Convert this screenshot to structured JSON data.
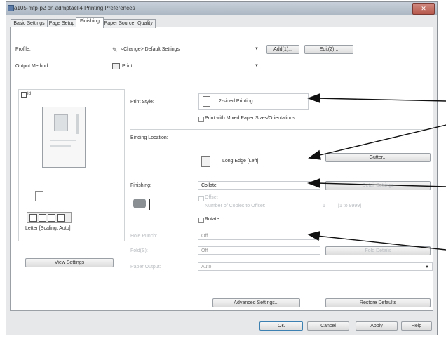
{
  "window": {
    "title": "a105-mfp-p2 on admptaeli4 Printing Preferences",
    "close_glyph": "✕"
  },
  "tabs": [
    {
      "label": "Basic Settings",
      "active": false
    },
    {
      "label": "Page Setup",
      "active": false
    },
    {
      "label": "Finishing",
      "active": true
    },
    {
      "label": "Paper Source",
      "active": false
    },
    {
      "label": "Quality",
      "active": false
    }
  ],
  "profile": {
    "label": "Profile:",
    "value": "<Change> Default Settings",
    "add_label": "Add(1)...",
    "edit_label": "Edit(2)..."
  },
  "output_method": {
    "label": "Output Method:",
    "value": "Print"
  },
  "preview": {
    "preview_label": "Id",
    "paper_caption": "Letter [Scaling: Auto]",
    "view_settings_label": "View Settings"
  },
  "print_style": {
    "label": "Print Style:",
    "value": "2-sided Printing",
    "mixed_label": "Print with Mixed Paper Sizes/Orientations",
    "mixed_checked": false
  },
  "binding": {
    "label": "Binding Location:",
    "value": "Long Edge [Left]",
    "gutter_label": "Gutter..."
  },
  "finishing": {
    "label": "Finishing:",
    "value": "Collate",
    "detail_label": "Detail Settings",
    "offset_label": "Offset",
    "offset_checked": false,
    "offset_sub_label": "Number of Copies to Offset:",
    "offset_sub_value": "1",
    "offset_sub_unit": "[1 to 9999]",
    "rotate_label": "Rotate",
    "rotate_checked": false
  },
  "hole_punch": {
    "label": "Hole Punch:",
    "value": "Off"
  },
  "fold": {
    "label": "Fold(S):",
    "value": "Off",
    "detail_label": "Fold Details"
  },
  "paper_output": {
    "label": "Paper Output:",
    "value": "Auto"
  },
  "buttons": {
    "advanced_label": "Advanced Settings...",
    "restore_label": "Restore Defaults",
    "ok_label": "OK",
    "cancel_label": "Cancel",
    "apply_label": "Apply",
    "help_label": "Help"
  }
}
